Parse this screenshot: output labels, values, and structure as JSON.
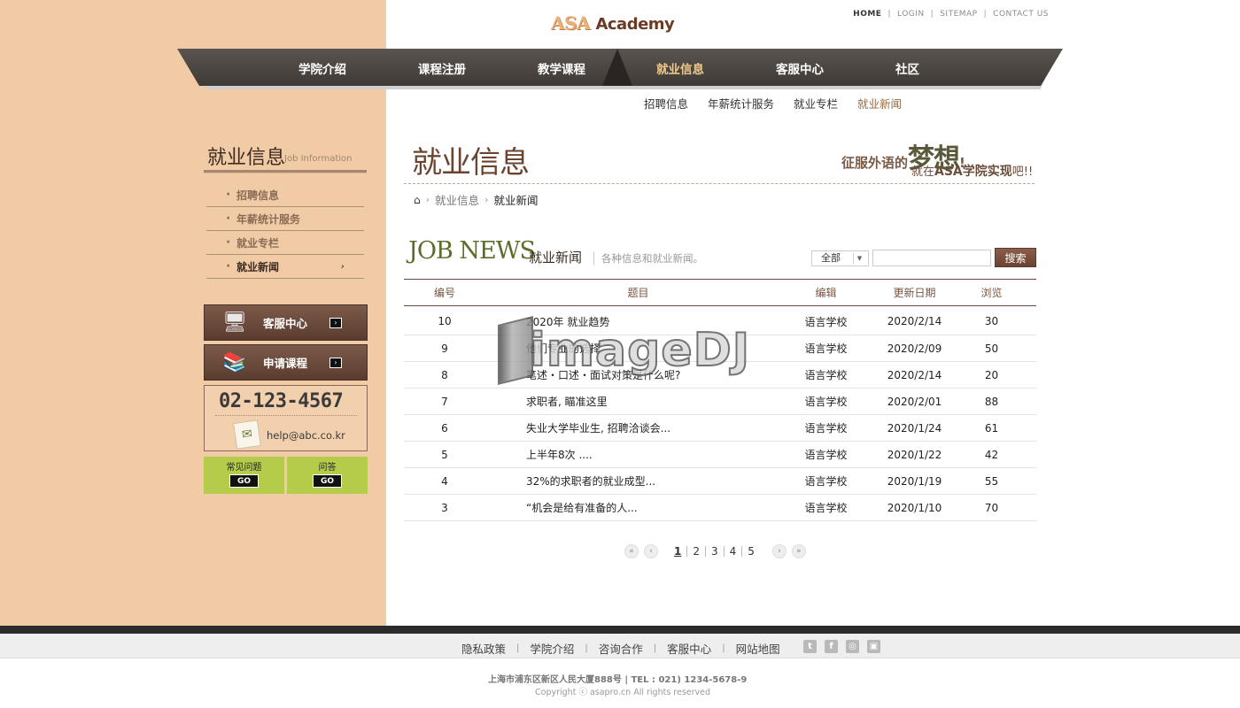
{
  "header": {
    "logo_main": "ASA",
    "logo_sub": "Academy",
    "top_links": [
      "HOME",
      "LOGIN",
      "SITEMAP",
      "CONTACT US"
    ]
  },
  "main_nav": [
    "学院介绍",
    "课程注册",
    "教学课程",
    "就业信息",
    "客服中心",
    "社区"
  ],
  "main_nav_active": "就业信息",
  "sub_nav": [
    "招聘信息",
    "年薪统计服务",
    "就业专栏",
    "就业新闻"
  ],
  "sub_nav_active": "就业新闻",
  "sidebar": {
    "title": "就业信息",
    "title_en": "Job Information",
    "items": [
      "招聘信息",
      "年薪统计服务",
      "就业专栏",
      "就业新闻"
    ],
    "active_arrow": "›",
    "buttons": [
      {
        "label": "客服中心",
        "icon": "computer-icon"
      },
      {
        "label": "申请课程",
        "icon": "books-icon"
      }
    ],
    "go_arrow": "›",
    "contact": {
      "phone": "02-123-4567",
      "email": "help@abc.co.kr"
    },
    "quick": [
      {
        "label": "常见问题",
        "go": "GO"
      },
      {
        "label": "问答",
        "go": "GO"
      }
    ]
  },
  "content": {
    "page_title": "就业信息",
    "slogan_part1": "征服外语的",
    "slogan_big": "梦想",
    "slogan_excl": "!",
    "slogan2_pre": "就在",
    "slogan2_asa": "ASA学院实现",
    "slogan2_post": "吧!!",
    "breadcrumb": [
      "就业信息",
      "就业新闻"
    ],
    "section_en": "JOB NEWS",
    "section_cn": "就业新闻",
    "section_desc": "各种信息和就业新闻。",
    "filter_value": "全部",
    "search_placeholder": "",
    "search_button": "搜索",
    "columns": [
      "编号",
      "题目",
      "编辑",
      "更新日期",
      "浏览"
    ],
    "rows": [
      {
        "no": "10",
        "title": "2020年 就业趋势",
        "editor": "语言学校",
        "date": "2020/2/14",
        "views": "30"
      },
      {
        "no": "9",
        "title": "他们专业的选择",
        "editor": "语言学校",
        "date": "2020/2/09",
        "views": "50"
      },
      {
        "no": "8",
        "title": "笔述・口述・面试对策是什么呢?",
        "editor": "语言学校",
        "date": "2020/2/14",
        "views": "20"
      },
      {
        "no": "7",
        "title": "求职者, 瞄准这里",
        "editor": "语言学校",
        "date": "2020/2/01",
        "views": "88"
      },
      {
        "no": "6",
        "title": "失业大学毕业生, 招聘洽谈会...",
        "editor": "语言学校",
        "date": "2020/1/24",
        "views": "61"
      },
      {
        "no": "5",
        "title": "上半年8次 ....",
        "editor": "语言学校",
        "date": "2020/1/22",
        "views": "42"
      },
      {
        "no": "4",
        "title": "32%的求职者的就业成型...",
        "editor": "语言学校",
        "date": "2020/1/19",
        "views": "55"
      },
      {
        "no": "3",
        "title": "“机会是给有准备的人...",
        "editor": "语言学校",
        "date": "2020/1/10",
        "views": "70"
      }
    ],
    "pagination": {
      "pages": [
        "1",
        "2",
        "3",
        "4",
        "5"
      ],
      "current": "1",
      "first": "«",
      "prev": "‹",
      "next": "›",
      "last": "»"
    }
  },
  "watermark": "imageDJ",
  "footer": {
    "links": [
      "隐私政策",
      "学院介绍",
      "咨询合作",
      "客服中心",
      "网站地图"
    ],
    "social": [
      {
        "icon": "twitter-icon",
        "glyph": "t"
      },
      {
        "icon": "facebook-icon",
        "glyph": "f"
      },
      {
        "icon": "instagram-icon",
        "glyph": "◎"
      },
      {
        "icon": "blog-icon",
        "glyph": "▣"
      }
    ],
    "address": "上海市浦东区新区人民大厦888号 | TEL : 021) 1234-5678-9",
    "copyright": "Copyright ⓒ asapro.cn All rights reserved"
  },
  "colors": {
    "accent_brown": "#6b4430",
    "sidebar_bg": "#f0cba6",
    "nav_dark": "#4a4541",
    "green": "#b5cc4a"
  }
}
